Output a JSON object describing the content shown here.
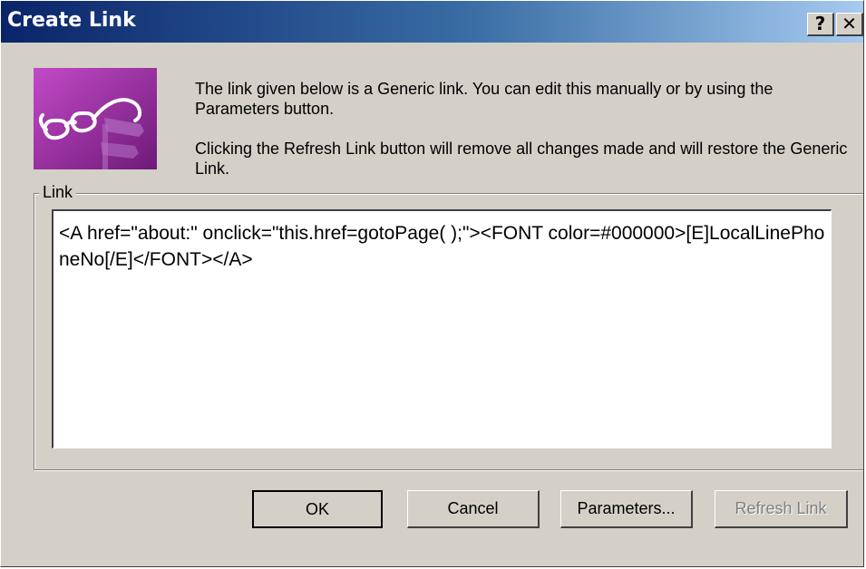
{
  "window": {
    "title": "Create Link",
    "help_button": "?",
    "close_button": "✕"
  },
  "message": {
    "line1": "The link given below is a Generic link. You can edit this manually or by using the Parameters button.",
    "line2": "Clicking the Refresh Link button will remove all changes made and will restore the Generic Link."
  },
  "link_group": {
    "label": "Link",
    "value": "<A href=\"about:\" onclick=\"this.href=gotoPage( );\"><FONT color=#000000>[E]LocalLinePhoneNo[/E]</FONT></A>"
  },
  "buttons": {
    "ok": "OK",
    "cancel": "Cancel",
    "parameters": "Parameters...",
    "refresh": "Refresh Link"
  },
  "icon": {
    "name": "glasses-signpost-icon"
  },
  "colors": {
    "titlebar_start": "#0a246a",
    "titlebar_end": "#a6caf0",
    "dialog_face": "#d4d0c8",
    "icon_background": "#9b2fa0"
  }
}
